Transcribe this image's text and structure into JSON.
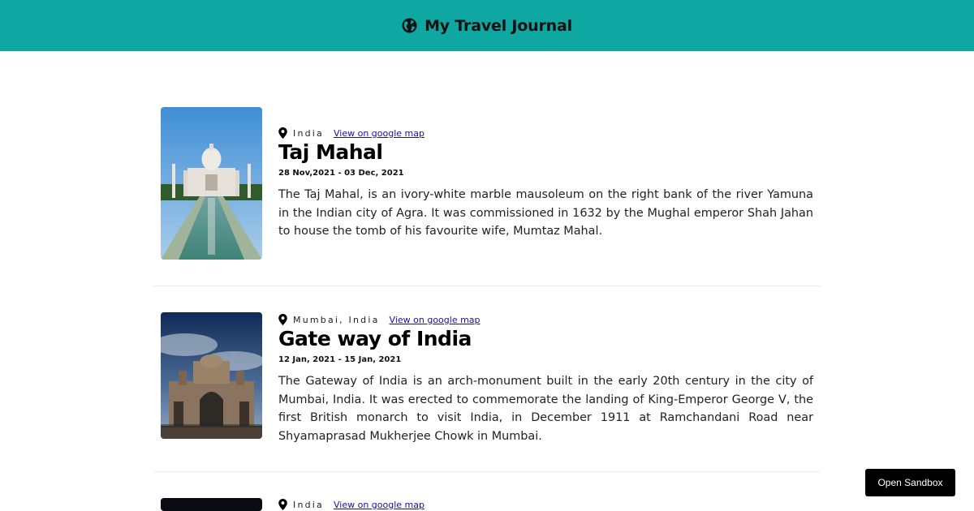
{
  "header": {
    "title": "My Travel Journal",
    "icon": "globe-icon"
  },
  "entries": [
    {
      "location": "India",
      "map_link": "View on google map",
      "title": "Taj Mahal",
      "dates": "28 Nov,2021 - 03 Dec, 2021",
      "description": "The Taj Mahal, is an ivory-white marble mausoleum on the right bank of the river Yamuna in the Indian city of Agra. It was commissioned in 1632 by the Mughal emperor Shah Jahan to house the tomb of his favourite wife, Mumtaz Mahal."
    },
    {
      "location": "Mumbai, India",
      "map_link": "View on google map",
      "title": "Gate way of India",
      "dates": "12 Jan, 2021 - 15 Jan, 2021",
      "description": "The Gateway of India is an arch-monument built in the early 20th century in the city of Mumbai, India. It was erected to commemorate the landing of King-Emperor George V, the first British monarch to visit India, in December 1911 at Ramchandani Road near Shyamaprasad Mukherjee Chowk in Mumbai."
    },
    {
      "location": "India",
      "map_link": "View on google map"
    }
  ],
  "sandbox_button": "Open Sandbox",
  "colors": {
    "header_bg": "#0ea7a2",
    "link": "#1a0dab",
    "button_bg": "#000000"
  }
}
